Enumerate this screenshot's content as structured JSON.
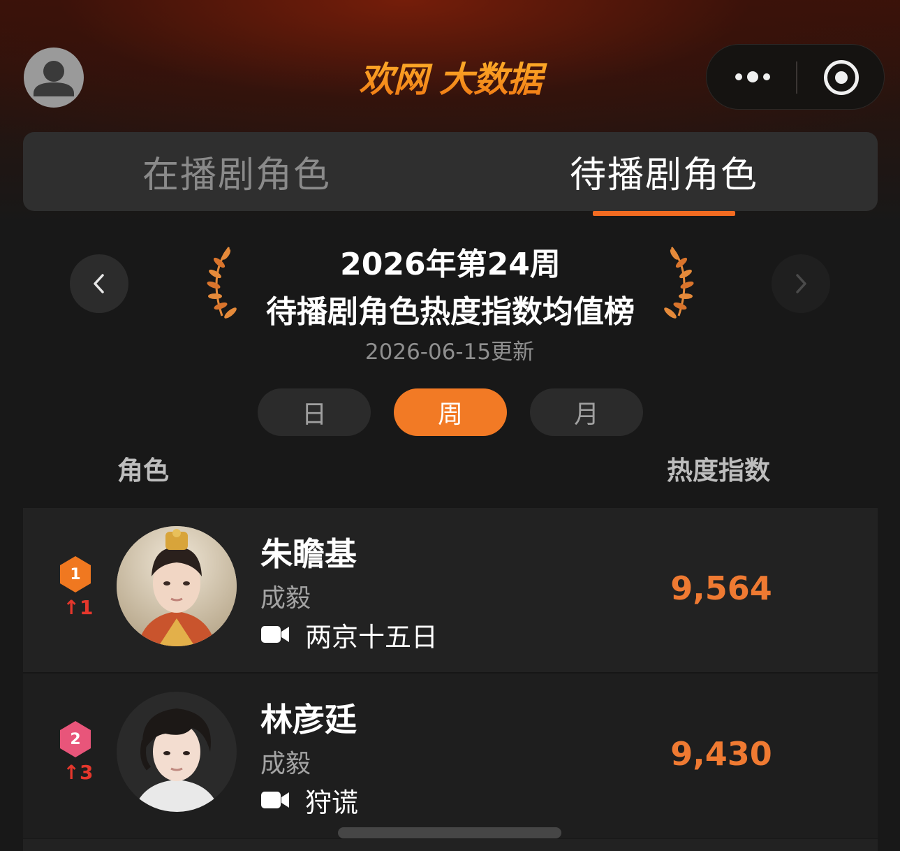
{
  "header": {
    "brand": "欢网 大数据",
    "avatar_icon": "user-avatar-icon",
    "more_icon": "more-dots-icon",
    "close_icon": "target-close-icon"
  },
  "tabs": [
    {
      "label": "在播剧角色",
      "active": false
    },
    {
      "label": "待播剧角色",
      "active": true
    }
  ],
  "title": {
    "week": "2026年第24周",
    "name": "待播剧角色热度指数均值榜",
    "updated": "2026-06-15更新"
  },
  "periods": [
    {
      "label": "日",
      "active": false
    },
    {
      "label": "周",
      "active": true
    },
    {
      "label": "月",
      "active": false
    }
  ],
  "columns": {
    "role": "角色",
    "heat": "热度指数"
  },
  "rows": [
    {
      "rank": "1",
      "change": "↑1",
      "character": "朱瞻基",
      "actor": "成毅",
      "drama": "两京十五日",
      "heat": "9,564",
      "badge_color": "#f07820"
    },
    {
      "rank": "2",
      "change": "↑3",
      "character": "林彦廷",
      "actor": "成毅",
      "drama": "狩谎",
      "heat": "9,430",
      "badge_color": "#e8557a"
    }
  ],
  "colors": {
    "accent": "#f27a25",
    "heat": "#ef7a32",
    "rank_up": "#e5372c"
  }
}
